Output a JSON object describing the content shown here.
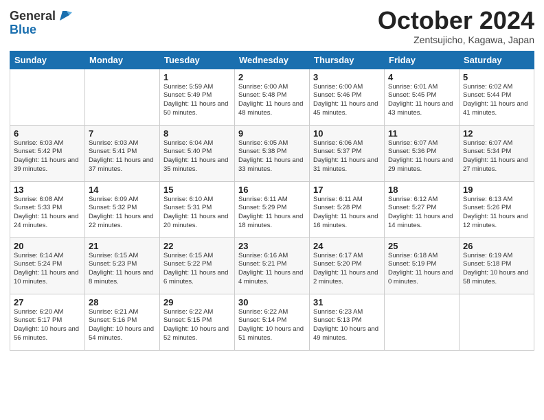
{
  "header": {
    "logo_general": "General",
    "logo_blue": "Blue",
    "month_title": "October 2024",
    "subtitle": "Zentsujicho, Kagawa, Japan"
  },
  "weekdays": [
    "Sunday",
    "Monday",
    "Tuesday",
    "Wednesday",
    "Thursday",
    "Friday",
    "Saturday"
  ],
  "weeks": [
    [
      {
        "day": "",
        "info": ""
      },
      {
        "day": "",
        "info": ""
      },
      {
        "day": "1",
        "info": "Sunrise: 5:59 AM\nSunset: 5:49 PM\nDaylight: 11 hours and 50 minutes."
      },
      {
        "day": "2",
        "info": "Sunrise: 6:00 AM\nSunset: 5:48 PM\nDaylight: 11 hours and 48 minutes."
      },
      {
        "day": "3",
        "info": "Sunrise: 6:00 AM\nSunset: 5:46 PM\nDaylight: 11 hours and 45 minutes."
      },
      {
        "day": "4",
        "info": "Sunrise: 6:01 AM\nSunset: 5:45 PM\nDaylight: 11 hours and 43 minutes."
      },
      {
        "day": "5",
        "info": "Sunrise: 6:02 AM\nSunset: 5:44 PM\nDaylight: 11 hours and 41 minutes."
      }
    ],
    [
      {
        "day": "6",
        "info": "Sunrise: 6:03 AM\nSunset: 5:42 PM\nDaylight: 11 hours and 39 minutes."
      },
      {
        "day": "7",
        "info": "Sunrise: 6:03 AM\nSunset: 5:41 PM\nDaylight: 11 hours and 37 minutes."
      },
      {
        "day": "8",
        "info": "Sunrise: 6:04 AM\nSunset: 5:40 PM\nDaylight: 11 hours and 35 minutes."
      },
      {
        "day": "9",
        "info": "Sunrise: 6:05 AM\nSunset: 5:38 PM\nDaylight: 11 hours and 33 minutes."
      },
      {
        "day": "10",
        "info": "Sunrise: 6:06 AM\nSunset: 5:37 PM\nDaylight: 11 hours and 31 minutes."
      },
      {
        "day": "11",
        "info": "Sunrise: 6:07 AM\nSunset: 5:36 PM\nDaylight: 11 hours and 29 minutes."
      },
      {
        "day": "12",
        "info": "Sunrise: 6:07 AM\nSunset: 5:34 PM\nDaylight: 11 hours and 27 minutes."
      }
    ],
    [
      {
        "day": "13",
        "info": "Sunrise: 6:08 AM\nSunset: 5:33 PM\nDaylight: 11 hours and 24 minutes."
      },
      {
        "day": "14",
        "info": "Sunrise: 6:09 AM\nSunset: 5:32 PM\nDaylight: 11 hours and 22 minutes."
      },
      {
        "day": "15",
        "info": "Sunrise: 6:10 AM\nSunset: 5:31 PM\nDaylight: 11 hours and 20 minutes."
      },
      {
        "day": "16",
        "info": "Sunrise: 6:11 AM\nSunset: 5:29 PM\nDaylight: 11 hours and 18 minutes."
      },
      {
        "day": "17",
        "info": "Sunrise: 6:11 AM\nSunset: 5:28 PM\nDaylight: 11 hours and 16 minutes."
      },
      {
        "day": "18",
        "info": "Sunrise: 6:12 AM\nSunset: 5:27 PM\nDaylight: 11 hours and 14 minutes."
      },
      {
        "day": "19",
        "info": "Sunrise: 6:13 AM\nSunset: 5:26 PM\nDaylight: 11 hours and 12 minutes."
      }
    ],
    [
      {
        "day": "20",
        "info": "Sunrise: 6:14 AM\nSunset: 5:24 PM\nDaylight: 11 hours and 10 minutes."
      },
      {
        "day": "21",
        "info": "Sunrise: 6:15 AM\nSunset: 5:23 PM\nDaylight: 11 hours and 8 minutes."
      },
      {
        "day": "22",
        "info": "Sunrise: 6:15 AM\nSunset: 5:22 PM\nDaylight: 11 hours and 6 minutes."
      },
      {
        "day": "23",
        "info": "Sunrise: 6:16 AM\nSunset: 5:21 PM\nDaylight: 11 hours and 4 minutes."
      },
      {
        "day": "24",
        "info": "Sunrise: 6:17 AM\nSunset: 5:20 PM\nDaylight: 11 hours and 2 minutes."
      },
      {
        "day": "25",
        "info": "Sunrise: 6:18 AM\nSunset: 5:19 PM\nDaylight: 11 hours and 0 minutes."
      },
      {
        "day": "26",
        "info": "Sunrise: 6:19 AM\nSunset: 5:18 PM\nDaylight: 10 hours and 58 minutes."
      }
    ],
    [
      {
        "day": "27",
        "info": "Sunrise: 6:20 AM\nSunset: 5:17 PM\nDaylight: 10 hours and 56 minutes."
      },
      {
        "day": "28",
        "info": "Sunrise: 6:21 AM\nSunset: 5:16 PM\nDaylight: 10 hours and 54 minutes."
      },
      {
        "day": "29",
        "info": "Sunrise: 6:22 AM\nSunset: 5:15 PM\nDaylight: 10 hours and 52 minutes."
      },
      {
        "day": "30",
        "info": "Sunrise: 6:22 AM\nSunset: 5:14 PM\nDaylight: 10 hours and 51 minutes."
      },
      {
        "day": "31",
        "info": "Sunrise: 6:23 AM\nSunset: 5:13 PM\nDaylight: 10 hours and 49 minutes."
      },
      {
        "day": "",
        "info": ""
      },
      {
        "day": "",
        "info": ""
      }
    ]
  ]
}
